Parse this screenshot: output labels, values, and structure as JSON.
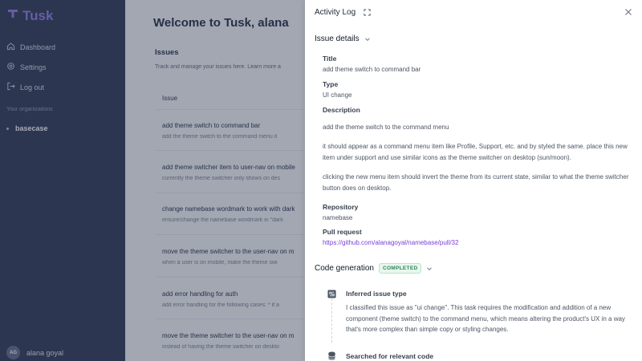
{
  "app": {
    "logo_text": "Tusk",
    "brand_color": "#8e7ae3"
  },
  "sidebar": {
    "items": [
      {
        "label": "Dashboard",
        "icon": "home-icon"
      },
      {
        "label": "Settings",
        "icon": "gear-icon"
      },
      {
        "label": "Log out",
        "icon": "logout-icon"
      }
    ],
    "org_section_title": "Your organizations",
    "org": "basecase",
    "user": {
      "initials": "AG",
      "name": "alana goyal"
    }
  },
  "main": {
    "welcome": "Welcome to Tusk, alana",
    "issues_title": "Issues",
    "issues_subtitle": "Track and manage your issues here. Learn more a",
    "column_header": "Issue",
    "rows": [
      {
        "title": "add theme switch to command bar",
        "desc": "add the theme switch to the command menu it"
      },
      {
        "title": "add theme switcher item to user-nav on mobile",
        "desc": "currently the theme switcher only shows on des"
      },
      {
        "title": "change namebase wordmark to work with dark",
        "desc": "ensure/change the namebase wordmark in \"dark"
      },
      {
        "title": "move the theme switcher to the user-nav on m",
        "desc": "when a user is on mobile, make the theme swi"
      },
      {
        "title": "add error handling for auth",
        "desc": "add error handling for the following cases: * if a"
      },
      {
        "title": "move the theme switcher to the user-nav on m",
        "desc": "instead of having the theme switcher on deskto"
      }
    ]
  },
  "panel": {
    "title": "Activity Log",
    "issue_details_heading": "Issue details",
    "title_label": "Title",
    "title_value": "add theme switch to command bar",
    "type_label": "Type",
    "type_value": "UI change",
    "description_label": "Description",
    "description": [
      "add the theme switch to the command menu",
      "it should appear as a command menu item like Profile, Support, etc. and by styled the same. place this new item under support and use similar icons as the theme switcher on desktop (sun/moon).",
      "clicking the new menu item should invert the theme from its current state, similar to what the theme switcher button does on desktop."
    ],
    "repository_label": "Repository",
    "repository_value": "namebase",
    "pr_label": "Pull request",
    "pr_url": "https://github.com/alanagoyal/namebase/pull/32",
    "code_gen_heading": "Code generation",
    "code_gen_status": "COMPLETED",
    "steps": [
      {
        "title": "Inferred issue type",
        "icon": "gitlab-icon",
        "text": "I classified this issue as \"ui change\". This task requires the modification and addition of a new component (theme switch) to the command menu, which means altering the product's UX in a way that's more complex than simple copy or styling changes."
      },
      {
        "title": "Searched for relevant code",
        "icon": "database-icon",
        "text": ""
      }
    ]
  }
}
